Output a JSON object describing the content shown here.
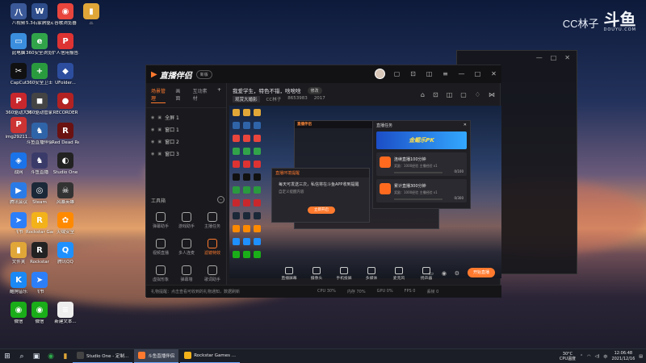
{
  "watermark": {
    "user": "CC林子",
    "logo": "斗鱼",
    "sub": "DOUYU.COM"
  },
  "desktop_icons": [
    {
      "label": "八视频",
      "color": "#3b5998",
      "glyph": "八"
    },
    {
      "label": "5.3石家驹驱动...",
      "color": "#2e4d8a",
      "glyph": "W"
    },
    {
      "label": "谷歌浏览器",
      "color": "#e8453c",
      "glyph": "◉"
    },
    {
      "label": "三",
      "color": "#e0a638",
      "glyph": "▮"
    },
    {
      "label": "此电脑",
      "color": "#3b8ede",
      "glyph": "▭"
    },
    {
      "label": "360安全浏览器",
      "color": "#31a44a",
      "glyph": "e"
    },
    {
      "label": "个人信用报告...pdf",
      "color": "#d33",
      "glyph": "P"
    },
    {
      "label": "CapCut",
      "color": "#111",
      "glyph": "✂"
    },
    {
      "label": "360安全卫士",
      "color": "#2a9a3e",
      "glyph": "+"
    },
    {
      "label": "UFolder...",
      "color": "#2d4e9e",
      "glyph": "◆"
    },
    {
      "label": "360驱动大师",
      "color": "#c8282d",
      "glyph": "P"
    },
    {
      "label": "360驱动管家",
      "color": "#444",
      "glyph": "◼"
    },
    {
      "label": "RECORDER",
      "color": "#b22222",
      "glyph": "●"
    },
    {
      "label": "img29211...",
      "color": "#c33",
      "glyph": "P"
    },
    {
      "label": "斗鱼直播伴侣",
      "color": "#2f64a8",
      "glyph": "♞"
    },
    {
      "label": "Red Dead Redemption",
      "color": "#6b1212",
      "glyph": "R"
    },
    {
      "label": "战网",
      "color": "#1a73e8",
      "glyph": "◈"
    },
    {
      "label": "斗鱼直播",
      "color": "#3b3b6a",
      "glyph": "♞"
    },
    {
      "label": "Studio One",
      "color": "#222",
      "glyph": "◐"
    },
    {
      "label": "腾讯会议",
      "color": "#2b7be6",
      "glyph": "▶"
    },
    {
      "label": "Steam",
      "color": "#1b2838",
      "glyph": "◎"
    },
    {
      "label": "风暴英雄",
      "color": "#333",
      "glyph": "☠"
    },
    {
      "label": "飞书",
      "color": "#2d7ff9",
      "glyph": "➤"
    },
    {
      "label": "Rockstar Games",
      "color": "#f3b21a",
      "glyph": "R"
    },
    {
      "label": "火绒安全",
      "color": "#ff8a00",
      "glyph": "✿"
    },
    {
      "label": "文件夹",
      "color": "#e0a638",
      "glyph": "▮"
    },
    {
      "label": "Rockstar",
      "color": "#222",
      "glyph": "R"
    },
    {
      "label": "腾讯QQ",
      "color": "#1e90ff",
      "glyph": "Q"
    },
    {
      "label": "酷狗音乐",
      "color": "#1a88f5",
      "glyph": "K"
    },
    {
      "label": "飞书",
      "color": "#2d7ff9",
      "glyph": "➤"
    },
    {
      "label": "微信",
      "color": "#1aad19",
      "glyph": "◉"
    },
    {
      "label": "微信",
      "color": "#1aad19",
      "glyph": "◉"
    },
    {
      "label": "新建文本...",
      "color": "#eee",
      "glyph": "≡"
    },
    {
      "label": "个人信用报告...pdf",
      "color": "#d33",
      "glyph": "P"
    }
  ],
  "app": {
    "title": "直播伴侣",
    "version": "新版",
    "left_tabs": [
      "场景管理",
      "画面",
      "互动素材"
    ],
    "scenes": [
      "全屏 1",
      "窗口 1",
      "窗口 2",
      "窗口 3"
    ],
    "tools_title": "工具箱",
    "tools": [
      {
        "label": "弹幕助手",
        "hot": false
      },
      {
        "label": "游戏助手",
        "hot": false
      },
      {
        "label": "主播任务",
        "hot": false
      },
      {
        "label": "视频直播",
        "hot": false
      },
      {
        "label": "多人连麦",
        "hot": false
      },
      {
        "label": "滤镜特效",
        "hot": true
      },
      {
        "label": "虚拟形象",
        "hot": false
      },
      {
        "label": "弹幕墙",
        "hot": false
      },
      {
        "label": "歌词助手",
        "hot": false
      }
    ],
    "stream_title": "我爱学生，特色不错，啥啥啥",
    "stream_badge": "修改",
    "room_chip": "观赏大婚影",
    "cc_label": "CC林子",
    "room_id": "8653983",
    "viewers": "2017",
    "preview": {
      "dialog_title": "直播环境提醒",
      "dialog_text": "每天可发送三次，私信将在斗鱼APP收到提醒",
      "dialog_link": "自定义提醒内容",
      "dialog_button": "立即开启",
      "task_title": "直播任务",
      "banner": "金鲲乐PK",
      "tasks": [
        {
          "title": "连续直播100分钟",
          "sub": "奖励：1000经验 主播经验 x1",
          "progress": "0/100"
        },
        {
          "title": "累计直播300分钟",
          "sub": "奖励：1000经验 主播经验 x1",
          "progress": "0/300"
        }
      ]
    },
    "bottom_buttons": [
      "直播屏幕",
      "摄像头",
      "手机投屏",
      "多媒体",
      "麦克风",
      "扬声器"
    ],
    "start_button": "开始直播",
    "status_message": "礼物提醒：点击查看可收到的礼物通知，数据刷新",
    "status_stats": [
      "CPU 30%",
      "内存 70%",
      "GPU 0%",
      "FPS 0",
      "丢帧 0"
    ]
  },
  "taskbar": {
    "apps": [
      {
        "label": "Studio One - 定制...",
        "color": "#444",
        "active": false
      },
      {
        "label": "斗鱼直播伴侣",
        "color": "#ff7a2e",
        "active": true
      },
      {
        "label": "Rockstar Games ...",
        "color": "#f3b21a",
        "active": false
      }
    ],
    "weather_temp": "30°C",
    "weather_label": "CPU温度",
    "time": "12:06:48",
    "date": "2021/12/16"
  }
}
